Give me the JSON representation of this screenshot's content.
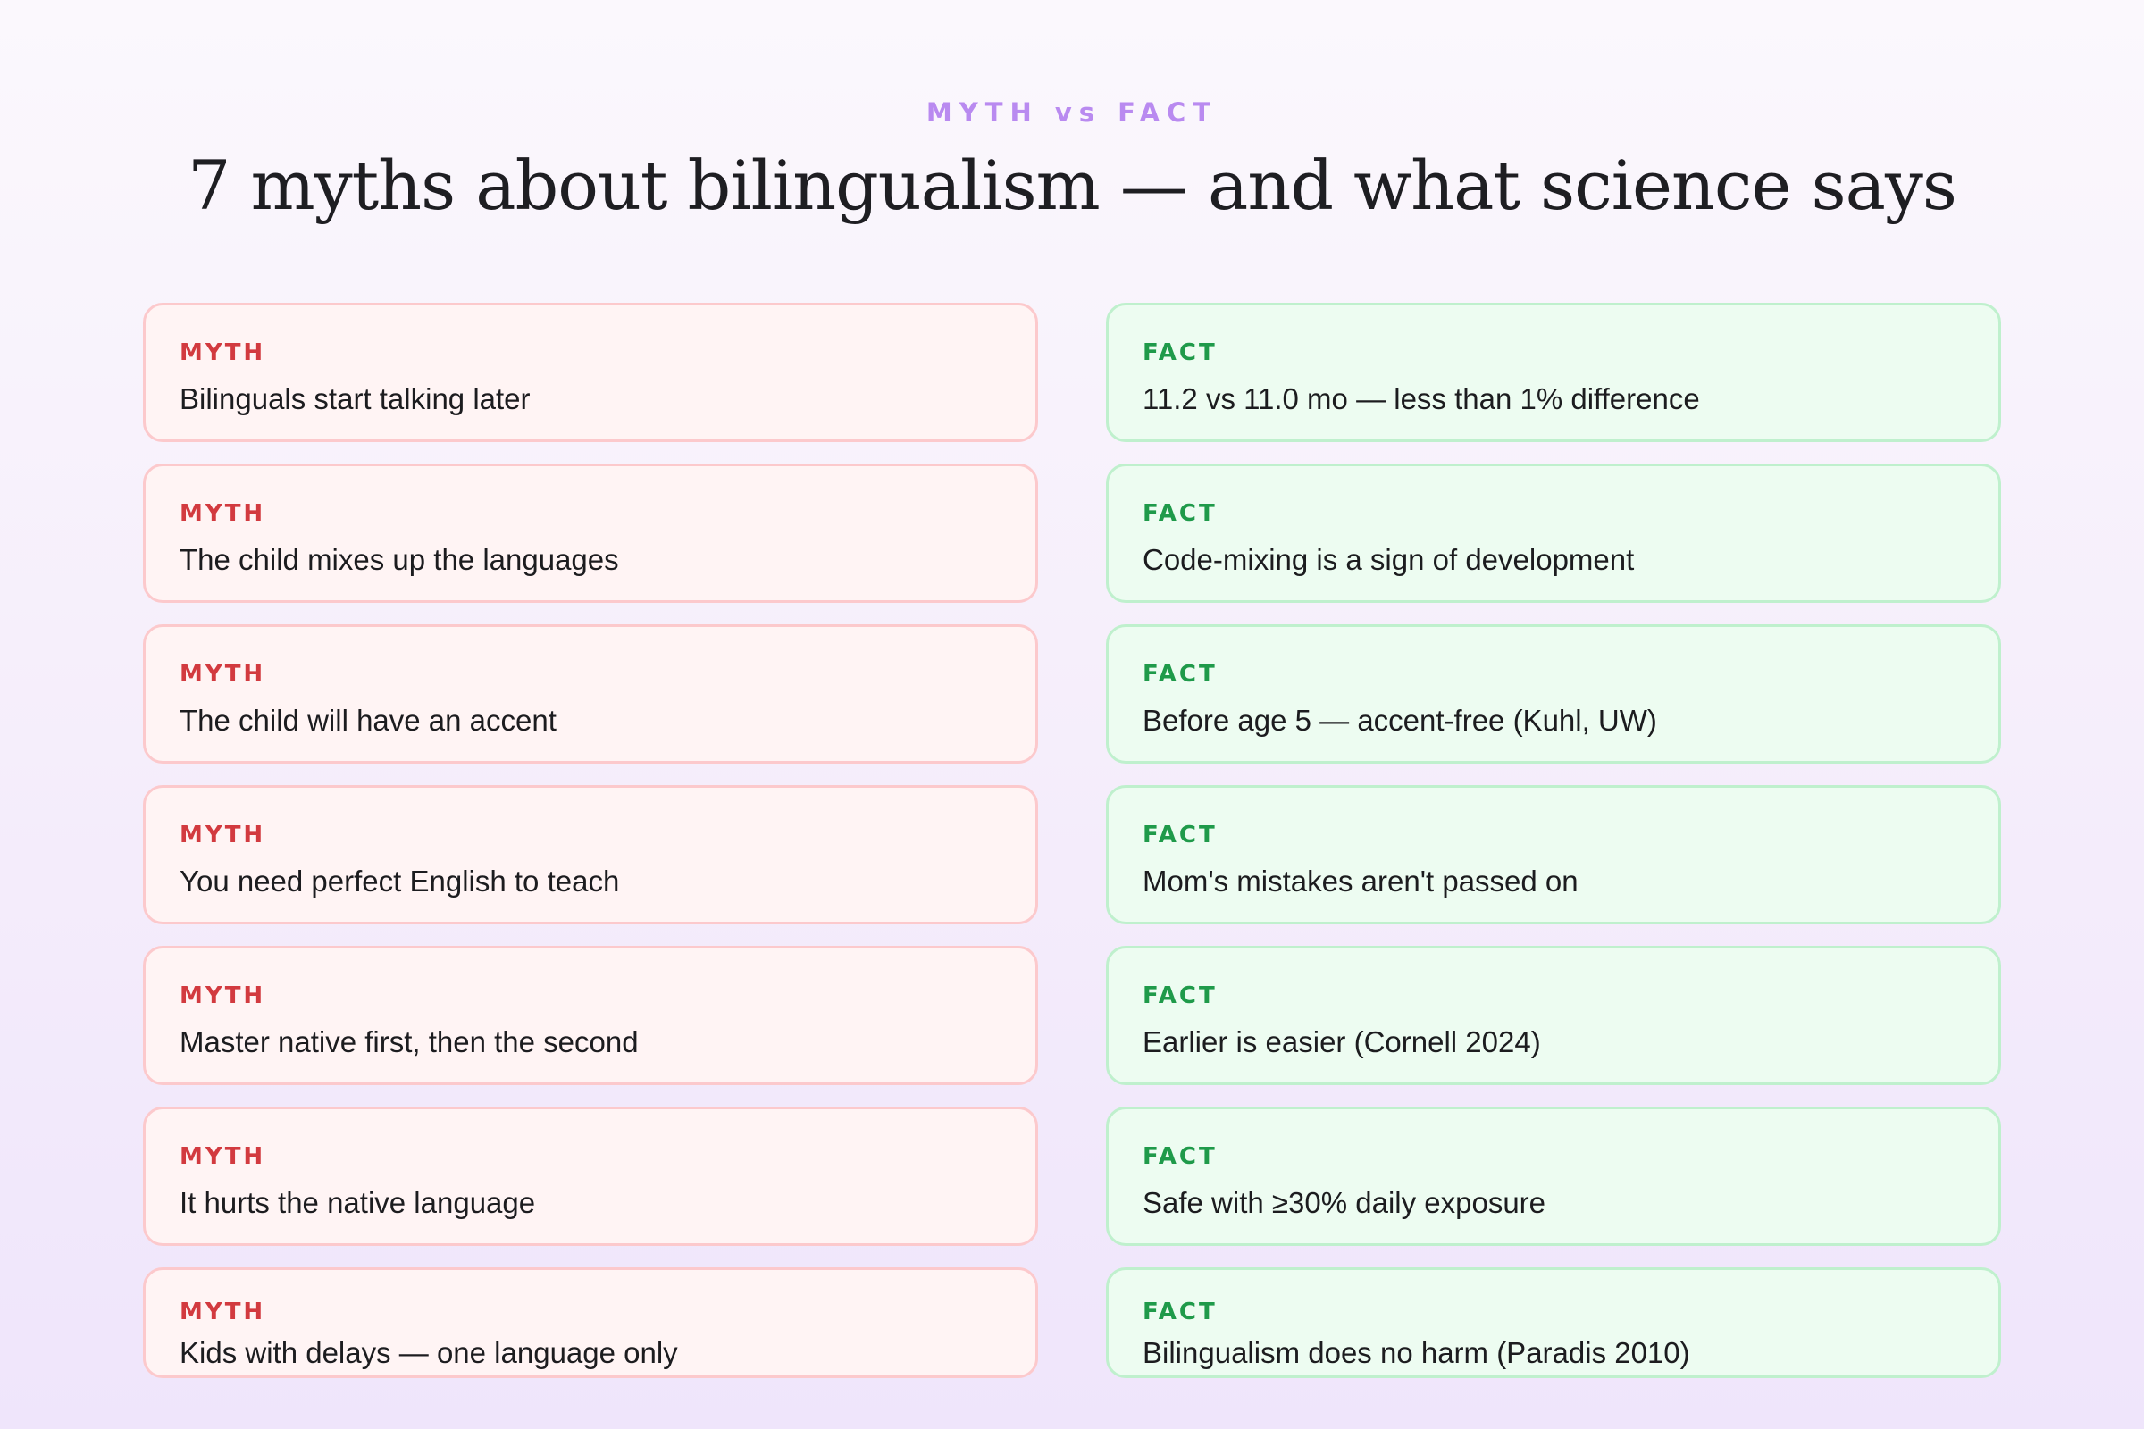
{
  "header": {
    "eyebrow": "MYTH vs FACT",
    "title": "7 myths about bilingualism — and what science says"
  },
  "labels": {
    "myth": "MYTH",
    "fact": "FACT"
  },
  "colors": {
    "eyebrow": "#b98af0",
    "myth_accent": "#d23a3f",
    "myth_bg": "#fff4f4",
    "myth_border": "#fcc9cc",
    "fact_accent": "#1f9a4a",
    "fact_bg": "#edfcf1",
    "fact_border": "#bff0cd"
  },
  "rows": [
    {
      "myth": "Bilinguals start talking later",
      "fact": "11.2 vs 11.0 mo — less than 1% difference"
    },
    {
      "myth": "The child mixes up the languages",
      "fact": "Code-mixing is a sign of development"
    },
    {
      "myth": "The child will have an accent",
      "fact": "Before age 5 — accent-free (Kuhl, UW)"
    },
    {
      "myth": "You need perfect English to teach",
      "fact": "Mom's mistakes aren't passed on"
    },
    {
      "myth": "Master native first, then the second",
      "fact": "Earlier is easier (Cornell 2024)"
    },
    {
      "myth": "It hurts the native language",
      "fact": "Safe with ≥30% daily exposure"
    },
    {
      "myth": "Kids with delays — one language only",
      "fact": "Bilingualism does no harm (Paradis 2010)"
    }
  ]
}
